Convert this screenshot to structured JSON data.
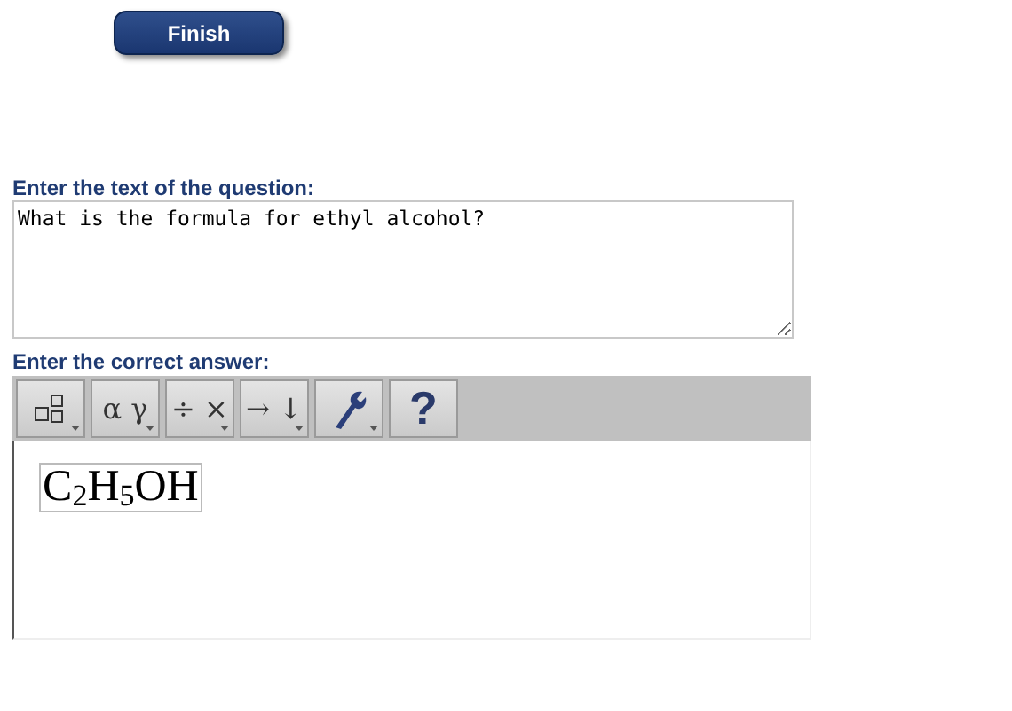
{
  "finish_button": {
    "label": "Finish"
  },
  "question": {
    "label": "Enter the text of the question:",
    "value": "What is the formula for ethyl alcohol?"
  },
  "answer": {
    "label": "Enter the correct answer:",
    "toolbar": [
      {
        "kind": "templates",
        "menu": true
      },
      {
        "kind": "text",
        "label": "α γ",
        "menu": true
      },
      {
        "kind": "text",
        "label": "÷ ×",
        "menu": true
      },
      {
        "kind": "text",
        "label": "→ ↓",
        "menu": true
      },
      {
        "kind": "wrench",
        "menu": true
      },
      {
        "kind": "help",
        "label": "?",
        "menu": false
      }
    ],
    "formula": "C$_{2}$H$_{5}$OH"
  }
}
